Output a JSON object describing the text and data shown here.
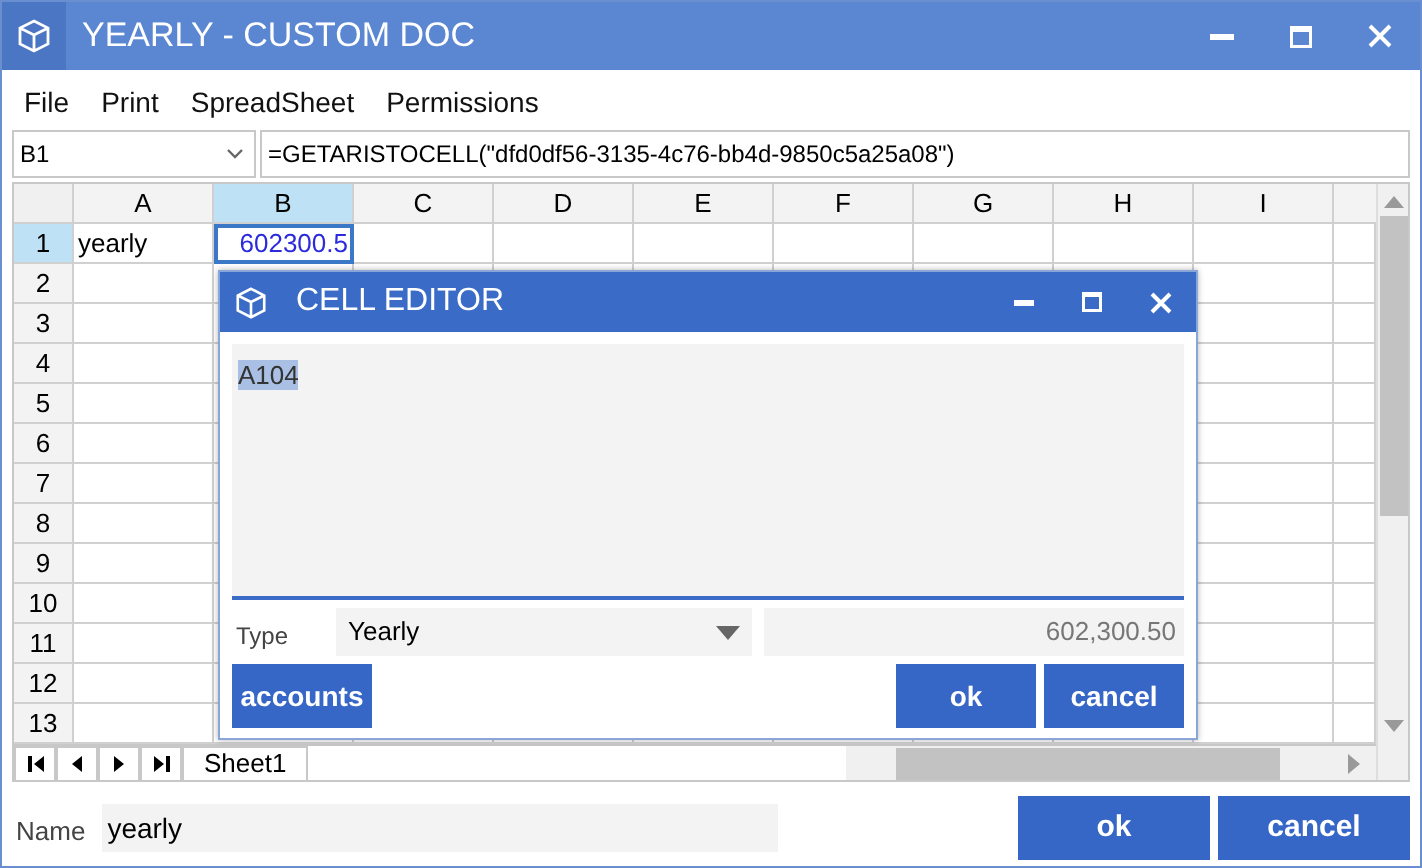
{
  "window": {
    "title": "YEARLY - CUSTOM DOC"
  },
  "menu": [
    "File",
    "Print",
    "SpreadSheet",
    "Permissions"
  ],
  "formula_bar": {
    "cell_ref": "B1",
    "formula": "=GETARISTOCELL(\"dfd0df56-3135-4c76-bb4d-9850c5a25a08\")"
  },
  "grid": {
    "columns": [
      {
        "label": "A",
        "selected": false
      },
      {
        "label": "B",
        "selected": true
      },
      {
        "label": "C",
        "selected": false
      },
      {
        "label": "D",
        "selected": false
      },
      {
        "label": "E",
        "selected": false
      },
      {
        "label": "F",
        "selected": false
      },
      {
        "label": "G",
        "selected": false
      },
      {
        "label": "H",
        "selected": false
      },
      {
        "label": "I",
        "selected": false
      }
    ],
    "rows": [
      {
        "label": "1",
        "selected": true,
        "cells": [
          {
            "text": "yearly",
            "selected": false
          },
          {
            "text": "602300.5",
            "selected": true
          }
        ]
      },
      {
        "label": "2",
        "selected": false,
        "cells": []
      },
      {
        "label": "3",
        "selected": false,
        "cells": []
      },
      {
        "label": "4",
        "selected": false,
        "cells": []
      },
      {
        "label": "5",
        "selected": false,
        "cells": []
      },
      {
        "label": "6",
        "selected": false,
        "cells": []
      },
      {
        "label": "7",
        "selected": false,
        "cells": []
      },
      {
        "label": "8",
        "selected": false,
        "cells": []
      },
      {
        "label": "9",
        "selected": false,
        "cells": []
      },
      {
        "label": "10",
        "selected": false,
        "cells": []
      },
      {
        "label": "11",
        "selected": false,
        "cells": []
      },
      {
        "label": "12",
        "selected": false,
        "cells": []
      },
      {
        "label": "13",
        "selected": false,
        "cells": []
      }
    ]
  },
  "sheet_tabs": [
    {
      "label": "Sheet1",
      "selected": true
    }
  ],
  "name_field": {
    "label": "Name",
    "value": "yearly"
  },
  "buttons": [
    "ok",
    "cancel"
  ],
  "dialog": {
    "title": "CELL EDITOR",
    "content": "A104",
    "type_label": "Type",
    "type_value": "Yearly",
    "value": "602,300.50",
    "buttons": [
      "accounts",
      "ok",
      "cancel"
    ]
  }
}
